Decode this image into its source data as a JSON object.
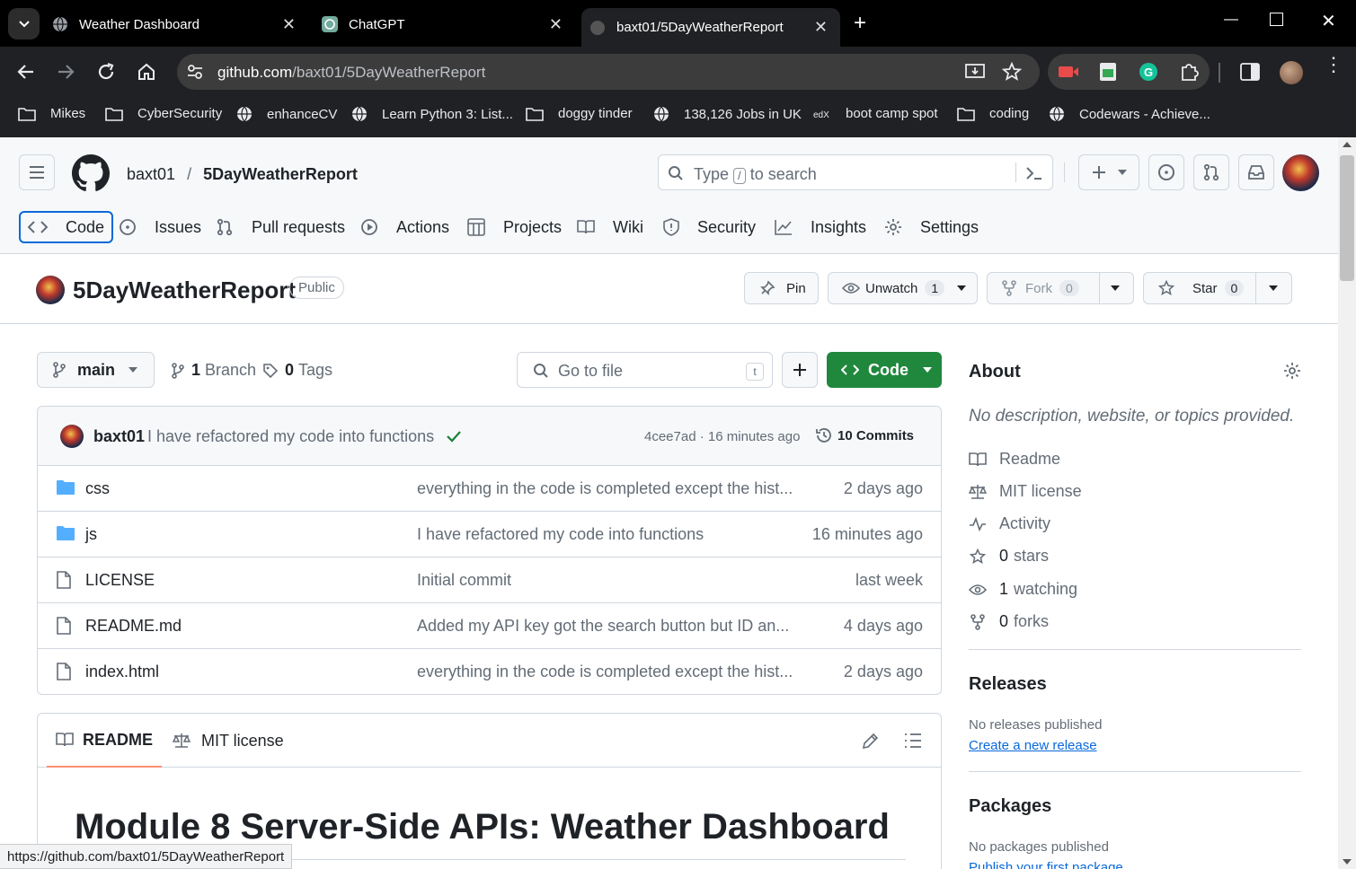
{
  "browser": {
    "tabs": [
      {
        "title": "Weather Dashboard"
      },
      {
        "title": "ChatGPT"
      },
      {
        "title": "baxt01/5DayWeatherReport"
      }
    ],
    "url_host": "github.com",
    "url_path": "/baxt01/5DayWeatherReport",
    "bookmarks": [
      {
        "label": "Mikes",
        "icon": "folder-icon"
      },
      {
        "label": "CyberSecurity",
        "icon": "folder-icon"
      },
      {
        "label": "enhanceCV",
        "icon": "globe-icon"
      },
      {
        "label": "Learn Python 3: List...",
        "icon": "globe-icon"
      },
      {
        "label": "doggy tinder",
        "icon": "folder-icon"
      },
      {
        "label": "138,126 Jobs in UK",
        "icon": "globe-icon"
      },
      {
        "label": "boot camp spot",
        "icon": "edx-icon"
      },
      {
        "label": "coding",
        "icon": "folder-icon"
      },
      {
        "label": "Codewars - Achieve...",
        "icon": "globe-icon"
      }
    ]
  },
  "header": {
    "owner": "baxt01",
    "separator": "/",
    "repo": "5DayWeatherReport",
    "search_pre": "Type",
    "search_key": "/",
    "search_post": "to search"
  },
  "repo_tabs": [
    {
      "label": "Code",
      "icon": "code-icon"
    },
    {
      "label": "Issues",
      "icon": "issue-icon"
    },
    {
      "label": "Pull requests",
      "icon": "pull-request-icon"
    },
    {
      "label": "Actions",
      "icon": "play-icon"
    },
    {
      "label": "Projects",
      "icon": "table-icon"
    },
    {
      "label": "Wiki",
      "icon": "book-icon"
    },
    {
      "label": "Security",
      "icon": "shield-icon"
    },
    {
      "label": "Insights",
      "icon": "graph-icon"
    },
    {
      "label": "Settings",
      "icon": "gear-icon"
    }
  ],
  "repo_head": {
    "name": "5DayWeatherReport",
    "visibility": "Public",
    "pin": "Pin",
    "unwatch": "Unwatch",
    "watch_count": "1",
    "fork": "Fork",
    "fork_count": "0",
    "star": "Star",
    "star_count": "0"
  },
  "branchbar": {
    "branch": "main",
    "branches_count": "1",
    "branches_label": "Branch",
    "tags_count": "0",
    "tags_label": "Tags",
    "goto_placeholder": "Go to file",
    "goto_key": "t",
    "code_button": "Code"
  },
  "commit": {
    "author": "baxt01",
    "message": "I have refactored my code into functions",
    "sha_time": "4cee7ad · 16 minutes ago",
    "commits": "10 Commits"
  },
  "files": [
    {
      "name": "css",
      "type": "folder",
      "message": "everything in the code is completed except the hist...",
      "age": "2 days ago"
    },
    {
      "name": "js",
      "type": "folder",
      "message": "I have refactored my code into functions",
      "age": "16 minutes ago"
    },
    {
      "name": "LICENSE",
      "type": "file",
      "message": "Initial commit",
      "age": "last week"
    },
    {
      "name": "README.md",
      "type": "file",
      "message": "Added my API key got the search button but ID an...",
      "age": "4 days ago"
    },
    {
      "name": "index.html",
      "type": "file",
      "message": "everything in the code is completed except the hist...",
      "age": "2 days ago"
    }
  ],
  "readme": {
    "tab_readme": "README",
    "tab_license": "MIT license",
    "heading": "Module 8 Server-Side APIs: Weather Dashboard"
  },
  "about": {
    "title": "About",
    "description": "No description, website, or topics provided.",
    "readme": "Readme",
    "license": "MIT license",
    "activity": "Activity",
    "stars_count": "0",
    "stars_label": "stars",
    "watching_count": "1",
    "watching_label": "watching",
    "forks_count": "0",
    "forks_label": "forks"
  },
  "releases": {
    "title": "Releases",
    "empty": "No releases published",
    "create": "Create a new release"
  },
  "packages": {
    "title": "Packages",
    "empty": "No packages published",
    "publish": "Publish your first package"
  },
  "status_url": "https://github.com/baxt01/5DayWeatherReport",
  "colors": {
    "accent": "#0969da",
    "primary_button": "#1f883d",
    "chrome_bg": "#202124"
  }
}
